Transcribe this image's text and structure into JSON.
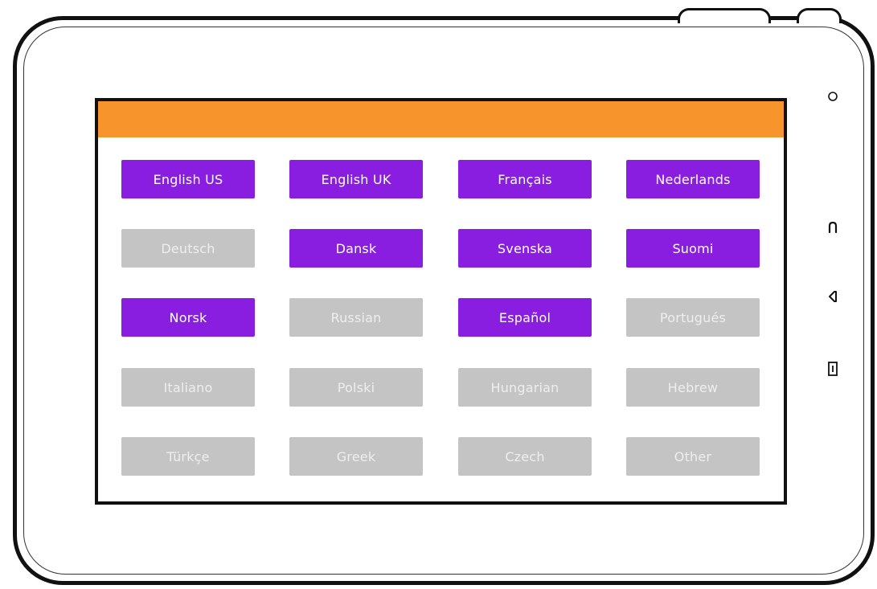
{
  "languages": [
    {
      "label": "English US",
      "enabled": true
    },
    {
      "label": "English UK",
      "enabled": true
    },
    {
      "label": "Français",
      "enabled": true
    },
    {
      "label": "Nederlands",
      "enabled": true
    },
    {
      "label": "Deutsch",
      "enabled": false
    },
    {
      "label": "Dansk",
      "enabled": true
    },
    {
      "label": "Svenska",
      "enabled": true
    },
    {
      "label": "Suomi",
      "enabled": true
    },
    {
      "label": "Norsk",
      "enabled": true
    },
    {
      "label": "Russian",
      "enabled": false
    },
    {
      "label": "Español",
      "enabled": true
    },
    {
      "label": "Portugués",
      "enabled": false
    },
    {
      "label": "Italiano",
      "enabled": false
    },
    {
      "label": "Polski",
      "enabled": false
    },
    {
      "label": "Hungarian",
      "enabled": false
    },
    {
      "label": "Hebrew",
      "enabled": false
    },
    {
      "label": "Türkçe",
      "enabled": false
    },
    {
      "label": "Greek",
      "enabled": false
    },
    {
      "label": "Czech",
      "enabled": false
    },
    {
      "label": "Other",
      "enabled": false
    }
  ],
  "colors": {
    "header": "#f7942b",
    "enabled_button": "#8a1ee0",
    "disabled_button": "#c4c4c4"
  },
  "hardware_icons": [
    "camera-icon",
    "home-icon",
    "back-icon",
    "menu-icon"
  ]
}
